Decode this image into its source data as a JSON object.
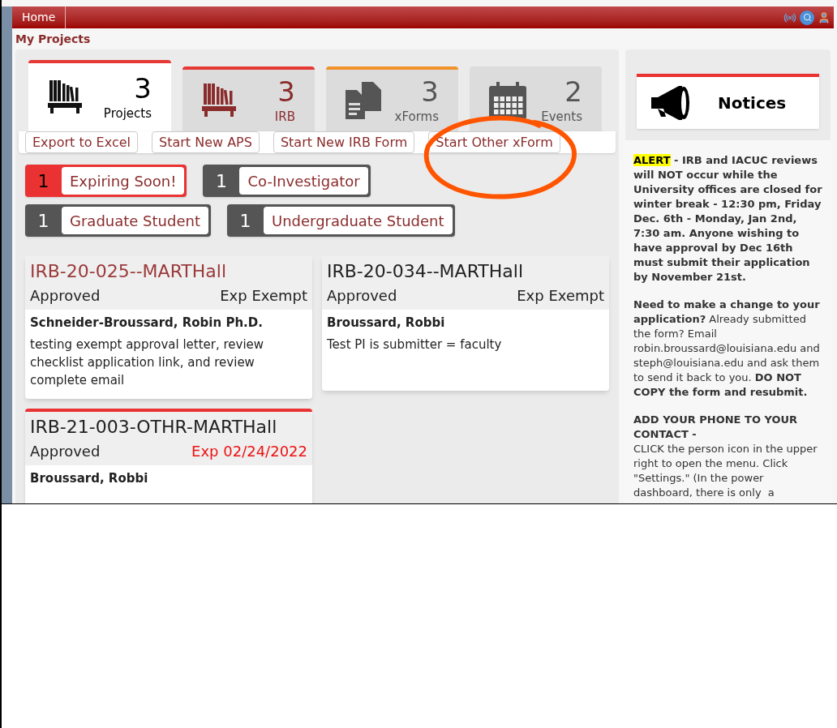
{
  "top_bar": {
    "home_tab": "Home"
  },
  "page_title": "My Projects",
  "tabs": [
    {
      "kind": "projects",
      "count": "3",
      "label": "Projects",
      "selected": true,
      "color": "#e53935"
    },
    {
      "kind": "irb",
      "count": "3",
      "label": "IRB",
      "selected": false,
      "color": "#e53935"
    },
    {
      "kind": "xforms",
      "count": "3",
      "label": "xForms",
      "selected": false,
      "color": "#f0932b"
    },
    {
      "kind": "events",
      "count": "2",
      "label": "Events",
      "selected": false
    }
  ],
  "actions": [
    "Export to Excel",
    "Start New APS",
    "Start New IRB Form",
    "Start Other xForm"
  ],
  "filters": [
    [
      {
        "count": "1",
        "label": "Expiring Soon!",
        "color": "#ea3233"
      },
      {
        "count": "1",
        "label": "Co-Investigator",
        "color": "#555555"
      }
    ],
    [
      {
        "count": "1",
        "label": "Graduate Student",
        "color": "#555555"
      },
      {
        "count": "1",
        "label": "Undergraduate Student",
        "color": "#555555"
      }
    ]
  ],
  "cards": [
    {
      "title": "IRB-20-025--MARTHall",
      "hovered": true,
      "kind": "normal",
      "status": "Approved",
      "expiry": "Exp Exempt",
      "person": "Schneider-Broussard, Robin Ph.D.",
      "description": "testing exempt approval letter, review checklist application link, and review complete email"
    },
    {
      "title": "IRB-20-034--MARTHall",
      "hovered": false,
      "kind": "normal",
      "status": "Approved",
      "expiry": "Exp Exempt",
      "person": "Broussard, Robbi",
      "description": "Test PI is submitter = faculty"
    },
    {
      "title": "IRB-21-003-OTHR-MARTHall",
      "hovered": false,
      "kind": "expiring",
      "status": "Approved",
      "expiry": "Exp 02/24/2022",
      "person": "Broussard, Robbi"
    }
  ],
  "notices": {
    "title": "Notices",
    "alert_label": "ALERT",
    "alert_text": "- IRB and IACUC reviews will NOT occur while the University offices are closed for winter break - 12:30 pm, Friday Dec. 6th - Monday, Jan 2nd, 7:30 am. Anyone wishing to have approval by Dec 16th must submit their application by November 21st.",
    "change_text": "**Need to make a change to your application?** Already submitted the form? Email robin.broussard@louisiana.edu and steph@louisiana.edu and ask them to send it back to you.  **DO NOT COPY the form and resubmit.**",
    "phone_heading": "ADD YOUR PHONE TO YOUR CONTACT -",
    "phone_text": "CLICK the person icon in the upper right to open the menu. Click \"Settings.\" (In the power dashboard, there is only  a"
  }
}
